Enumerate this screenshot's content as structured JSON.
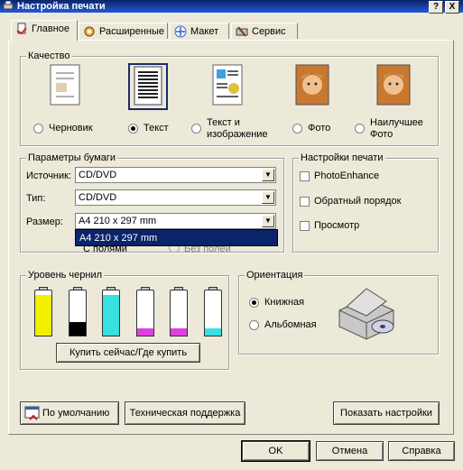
{
  "window": {
    "title": "Настройка печати",
    "help_btn": "?",
    "close_btn": "X"
  },
  "tabs": [
    "Главное",
    "Расширенные",
    "Макет",
    "Сервис"
  ],
  "quality": {
    "label": "Качество",
    "options": [
      {
        "line1": "Черновик",
        "line2": "",
        "selected": false
      },
      {
        "line1": "Текст",
        "line2": "",
        "selected": true
      },
      {
        "line1": "Текст и",
        "line2": "изображение",
        "selected": false
      },
      {
        "line1": "Фото",
        "line2": "",
        "selected": false
      },
      {
        "line1": "Наилучшее",
        "line2": "Фото",
        "selected": false
      }
    ]
  },
  "paper": {
    "label": "Параметры бумаги",
    "source_label": "Источник:",
    "source_value": "CD/DVD",
    "type_label": "Тип:",
    "type_value": "CD/DVD",
    "size_label": "Размер:",
    "size_value": "A4 210 x 297 mm",
    "dropdown_item": "A4 210 x 297 mm",
    "with_margins": "С полями",
    "no_margins": "Без полей"
  },
  "print_settings": {
    "label": "Настройки печати",
    "photo_enhance": "PhotoEnhance",
    "reverse_order": "Обратный порядок",
    "preview": "Просмотр"
  },
  "ink": {
    "label": "Уровень чернил",
    "buy_button": "Купить сейчас/Где купить",
    "cartridges": [
      {
        "color": "#f0f000",
        "level": 0.9
      },
      {
        "color": "#000000",
        "level": 0.3
      },
      {
        "color": "#38e0e0",
        "level": 0.9
      },
      {
        "color": "#e040e0",
        "level": 0.15
      },
      {
        "color": "#e040e0",
        "level": 0.15
      },
      {
        "color": "#38e0e0",
        "level": 0.15
      }
    ]
  },
  "orientation": {
    "label": "Ориентация",
    "portrait": "Книжная",
    "landscape": "Альбомная",
    "printer_icon": "printer-cd-icon"
  },
  "bottom": {
    "defaults": "По умолчанию",
    "support": "Техническая поддержка",
    "show_settings": "Показать настройки"
  },
  "dialog": {
    "ok": "OK",
    "cancel": "Отмена",
    "help": "Справка"
  }
}
